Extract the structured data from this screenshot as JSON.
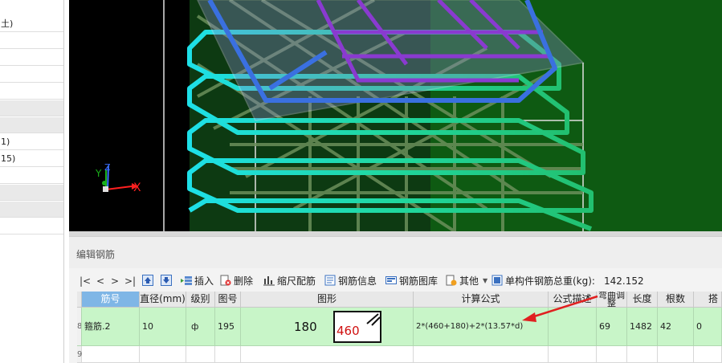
{
  "left_panel": {
    "rows": [
      "土)",
      "",
      "",
      "",
      "",
      "",
      "",
      "",
      "1)",
      "15)",
      "",
      "",
      "",
      ""
    ]
  },
  "viewport": {
    "axis_x_label": "X",
    "axis_y_label": "Y",
    "axis_z_label": "Z",
    "colors": {
      "background": "#000000",
      "slab": "#0e5a12",
      "red_axis": "#ff2020"
    }
  },
  "editor": {
    "title": "编辑钢筋",
    "nav": {
      "first": "|<",
      "prev": "<",
      "next": ">",
      "last": ">|"
    },
    "toolbar": {
      "insert": "插入",
      "delete": "删除",
      "scale_bar": "缩尺配筋",
      "rebar_info": "钢筋信息",
      "rebar_library": "钢筋图库",
      "other": "其他",
      "total_weight_label": "单构件钢筋总重(kg):",
      "total_weight_value": "142.152"
    },
    "columns": [
      "筋号",
      "直径(mm)",
      "级别",
      "图号",
      "图形",
      "计算公式",
      "公式描述",
      "弯曲调整",
      "长度",
      "根数",
      "搭"
    ],
    "rows": [
      {
        "row_no": "8",
        "name": "箍筋.2",
        "diameter": "10",
        "grade": "ф",
        "figure_no": "195",
        "shape_a": "180",
        "shape_b": "460",
        "formula": "2*(460+180)+2*(13.57*d)",
        "description": "",
        "bend_adjust": "69",
        "length": "1482",
        "count": "42",
        "lap": "0"
      }
    ],
    "next_row_no": "9"
  }
}
